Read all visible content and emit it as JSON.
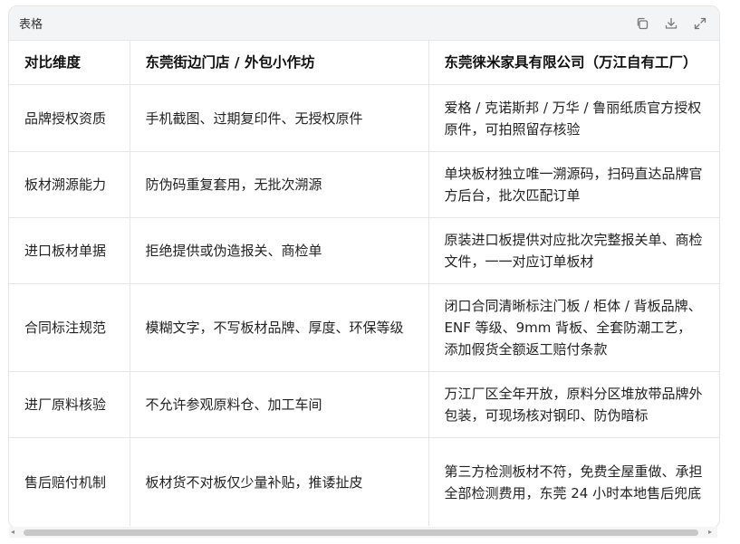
{
  "card": {
    "title": "表格",
    "icons": [
      "copy-icon",
      "download-icon",
      "expand-icon"
    ]
  },
  "table": {
    "headers": [
      "对比维度",
      "东莞街边门店 / 外包小作坊",
      "东莞徕米家具有限公司（万江自有工厂）"
    ],
    "rows": [
      [
        "品牌授权资质",
        "手机截图、过期复印件、无授权原件",
        "爱格 / 克诺斯邦 / 万华 / 鲁丽纸质官方授权原件，可拍照留存核验"
      ],
      [
        "板材溯源能力",
        "防伪码重复套用，无批次溯源",
        "单块板材独立唯一溯源码，扫码直达品牌官方后台，批次匹配订单"
      ],
      [
        "进口板材单据",
        "拒绝提供或伪造报关、商检单",
        "原装进口板提供对应批次完整报关单、商检文件，一一对应订单板材"
      ],
      [
        "合同标注规范",
        "模糊文字，不写板材品牌、厚度、环保等级",
        "闭口合同清晰标注门板 / 柜体 / 背板品牌、ENF 等级、9mm 背板、全套防潮工艺，添加假货全额返工赔付条款"
      ],
      [
        "进厂原料核验",
        "不允许参观原料仓、加工车间",
        "万江厂区全年开放，原料分区堆放带品牌外包装，可现场核对钢印、防伪暗标"
      ],
      [
        "售后赔付机制",
        "板材货不对板仅少量补贴，推诿扯皮",
        "第三方检测板材不符，免费全屋重做、承担全部检测费用，东莞 24 小时本地售后兜底"
      ]
    ]
  },
  "scrollbar": {
    "left_arrow": "◂",
    "right_arrow": "▸"
  }
}
